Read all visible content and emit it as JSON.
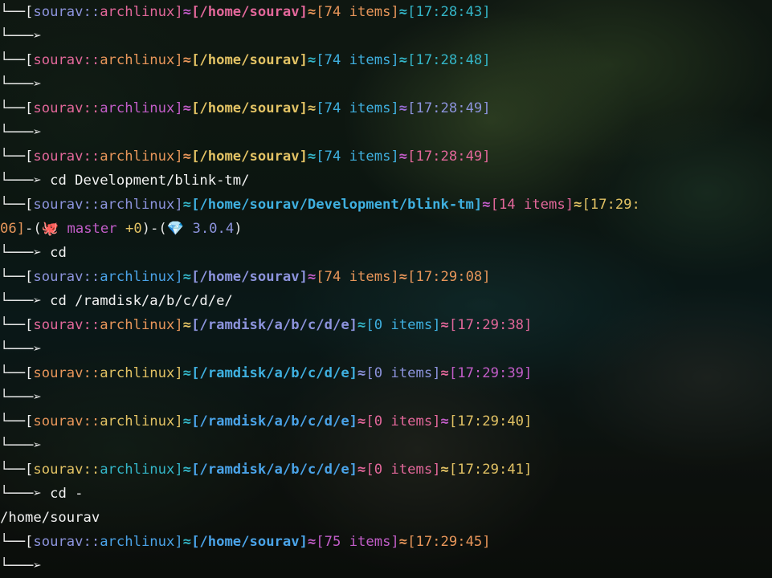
{
  "terminal": {
    "tree_top": "└──[",
    "tree_bottom": "└───➢",
    "blocks": [
      {
        "user": "sourav",
        "sep_user": "::",
        "host": "archlinux",
        "path": "[/home/sourav]",
        "items": "[74 items]",
        "time": "[17:28:43]",
        "command": "",
        "output": ""
      },
      {
        "user": "sourav",
        "sep_user": "::",
        "host": "archlinux",
        "path": "[/home/sourav]",
        "items": "[74 items]",
        "time": "[17:28:48]",
        "command": "",
        "output": ""
      },
      {
        "user": "sourav",
        "sep_user": "::",
        "host": "archlinux",
        "path": "[/home/sourav]",
        "items": "[74 items]",
        "time": "[17:28:49]",
        "command": "",
        "output": ""
      },
      {
        "user": "sourav",
        "sep_user": "::",
        "host": "archlinux",
        "path": "[/home/sourav]",
        "items": "[74 items]",
        "time": "[17:28:49]",
        "command": "cd Development/blink-tm/",
        "output": ""
      },
      {
        "user": "sourav",
        "sep_user": "::",
        "host": "archlinux",
        "path": "[/home/sourav/Development/blink-tm]",
        "items": "[14 items]",
        "time": "[17:29:",
        "time_wrap": "06]",
        "git": "master",
        "git_changes": "+0",
        "ruby_version": "3.0.4",
        "command": "cd",
        "output": ""
      },
      {
        "user": "sourav",
        "sep_user": "::",
        "host": "archlinux",
        "path": "[/home/sourav]",
        "items": "[74 items]",
        "time": "[17:29:08]",
        "command": "cd /ramdisk/a/b/c/d/e/",
        "output": ""
      },
      {
        "user": "sourav",
        "sep_user": "::",
        "host": "archlinux",
        "path": "[/ramdisk/a/b/c/d/e]",
        "items": "[0 items]",
        "time": "[17:29:38]",
        "command": "",
        "output": ""
      },
      {
        "user": "sourav",
        "sep_user": "::",
        "host": "archlinux",
        "path": "[/ramdisk/a/b/c/d/e]",
        "items": "[0 items]",
        "time": "[17:29:39]",
        "command": "",
        "output": ""
      },
      {
        "user": "sourav",
        "sep_user": "::",
        "host": "archlinux",
        "path": "[/ramdisk/a/b/c/d/e]",
        "items": "[0 items]",
        "time": "[17:29:40]",
        "command": "",
        "output": ""
      },
      {
        "user": "sourav",
        "sep_user": "::",
        "host": "archlinux",
        "path": "[/ramdisk/a/b/c/d/e]",
        "items": "[0 items]",
        "time": "[17:29:41]",
        "command": "cd -",
        "output": "/home/sourav"
      },
      {
        "user": "sourav",
        "sep_user": "::",
        "host": "archlinux",
        "path": "[/home/sourav]",
        "items": "[75 items]",
        "time": "[17:29:45]",
        "command": "",
        "output": ""
      }
    ]
  },
  "colors": {
    "blue": "#4aa3e8",
    "lavender": "#8c93dc",
    "pink": "#e2679a",
    "magenta": "#c25dc8",
    "orange": "#e8965a",
    "yellow": "#e2c264",
    "teal": "#34b6c8"
  },
  "icons": {
    "separator": "≈-wave-glyph",
    "git": "octopus-icon",
    "ruby": "gem-icon"
  }
}
